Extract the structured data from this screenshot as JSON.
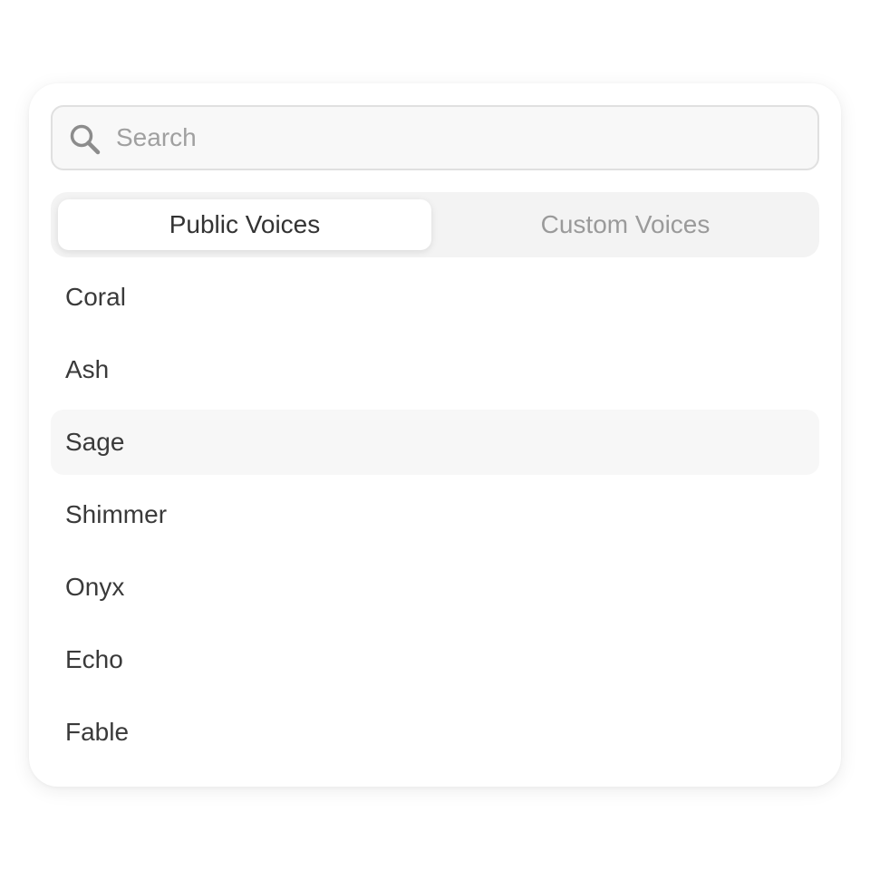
{
  "search": {
    "placeholder": "Search",
    "value": "",
    "icon": "search-icon"
  },
  "tabs": [
    {
      "label": "Public Voices",
      "selected": true
    },
    {
      "label": "Custom Voices",
      "selected": false
    }
  ],
  "voices": [
    {
      "label": "Coral"
    },
    {
      "label": "Ash"
    },
    {
      "label": "Sage",
      "highlighted": true
    },
    {
      "label": "Shimmer"
    },
    {
      "label": "Onyx"
    },
    {
      "label": "Echo"
    },
    {
      "label": "Fable"
    }
  ],
  "colors": {
    "active_text": "#333333",
    "inactive_text": "#9a9a9a",
    "highlight_bg": "#f7f7f7"
  }
}
